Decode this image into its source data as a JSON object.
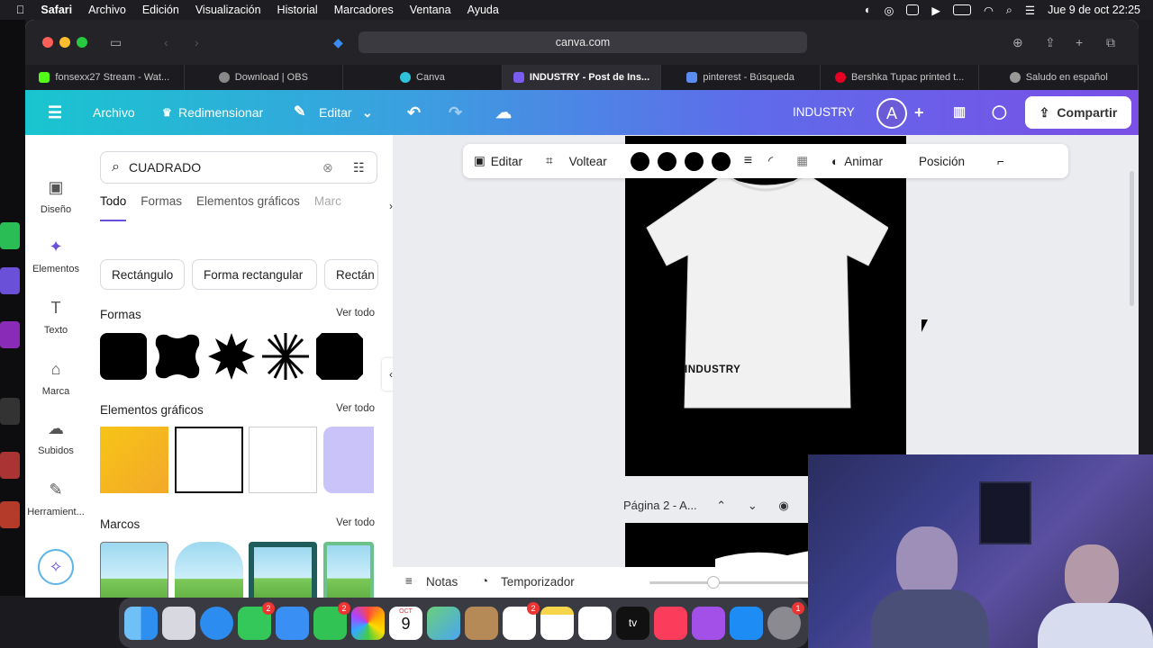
{
  "menubar": {
    "app": "Safari",
    "items": [
      "Archivo",
      "Edición",
      "Visualización",
      "Historial",
      "Marcadores",
      "Ventana",
      "Ayuda"
    ],
    "datetime": "Jue 9 de oct  22:25"
  },
  "browser": {
    "url": "canva.com",
    "tabs": [
      {
        "label": "fonsexx27 Stream - Wat...",
        "color": "#53fc18"
      },
      {
        "label": "Download | OBS",
        "color": "#888888"
      },
      {
        "label": "Canva",
        "color": "#2ec3d8"
      },
      {
        "label": "INDUSTRY - Post de Ins...",
        "color": "#7b5cf0",
        "active": true
      },
      {
        "label": "pinterest - Búsqueda",
        "color": "#5b8cf0"
      },
      {
        "label": "Bershka Tupac printed t...",
        "color": "#e60023"
      },
      {
        "label": "Saludo en español",
        "color": "#999999"
      }
    ]
  },
  "header": {
    "archivo": "Archivo",
    "redimensionar": "Redimensionar",
    "editar": "Editar",
    "title": "INDUSTRY",
    "avatar": "A",
    "share": "Compartir"
  },
  "rail": {
    "items": [
      {
        "label": "Diseño",
        "icon": "layout-icon"
      },
      {
        "label": "Elementos",
        "icon": "elements-icon"
      },
      {
        "label": "Texto",
        "icon": "text-icon"
      },
      {
        "label": "Marca",
        "icon": "brand-icon"
      },
      {
        "label": "Subidos",
        "icon": "upload-icon"
      },
      {
        "label": "Herramient...",
        "icon": "tools-icon"
      }
    ]
  },
  "panel": {
    "search_value": "CUADRADO",
    "tabs": [
      "Todo",
      "Formas",
      "Elementos gráficos",
      "Marc"
    ],
    "chips": [
      "Rectángulo",
      "Forma rectangular",
      "Rectán"
    ],
    "formas_title": "Formas",
    "graficos_title": "Elementos gráficos",
    "marcos_title": "Marcos",
    "ver_todo": "Ver todo"
  },
  "context_toolbar": {
    "editar": "Editar",
    "voltear": "Voltear",
    "animar": "Animar",
    "posicion": "Posición"
  },
  "canvas": {
    "shirt_text": "INDUSTRY",
    "page_label": "Página 2 - A..."
  },
  "footer": {
    "notas": "Notas",
    "temporizador": "Temporizador"
  },
  "dock": {
    "calendar_month": "OCT",
    "calendar_day": "9",
    "apple_tv": "tv"
  }
}
